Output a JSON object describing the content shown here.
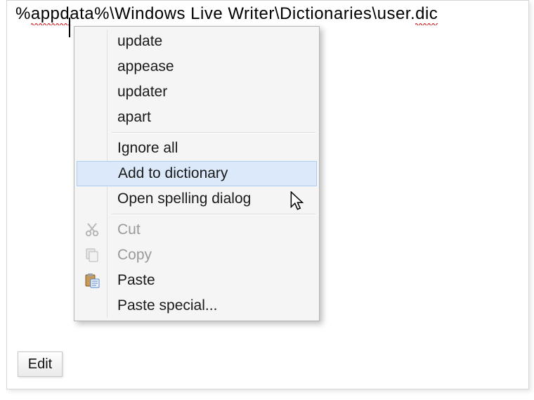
{
  "path": {
    "seg1_misspelled": "appd",
    "seg2_plain": "ata%\\Windows Live Writer\\Dictionaries\\user.",
    "seg3_misspelled": "dic",
    "prefix_percent": "%"
  },
  "context_menu": {
    "suggestions": [
      "update",
      "appease",
      "updater",
      "apart"
    ],
    "items": {
      "ignore_all": "Ignore all",
      "add_to_dictionary": "Add to dictionary",
      "open_spelling": "Open spelling dialog",
      "cut": "Cut",
      "copy": "Copy",
      "paste": "Paste",
      "paste_special": "Paste special..."
    }
  },
  "tabs": {
    "edit": "Edit"
  }
}
